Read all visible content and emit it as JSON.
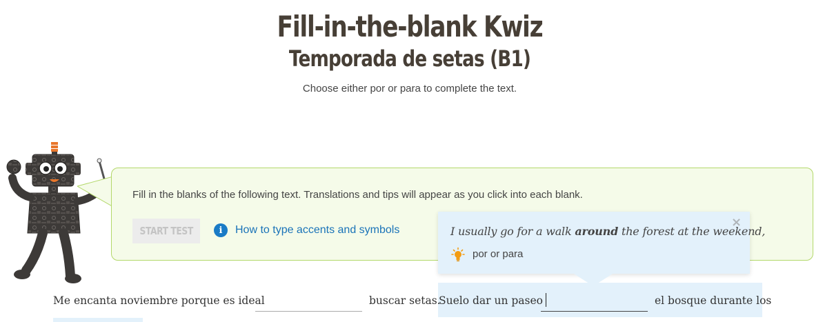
{
  "header": {
    "title": "Fill-in-the-blank Kwiz",
    "subtitle": "Temporada de setas (B1)",
    "instructions": "Choose either por or para to complete the text."
  },
  "intro": {
    "text": "Fill in the blanks of the following text. Translations and tips will appear as you click into each blank.",
    "start_button": "START TEST",
    "accents_link": "How to type accents and symbols"
  },
  "tooltip": {
    "translation_before": "I usually go for a walk ",
    "translation_bold": "around",
    "translation_after": " the forest at the weekend,",
    "hint": "por or para",
    "close_icon": "close-icon"
  },
  "exercise": {
    "segment_1": "Me encanta noviembre porque es ideal",
    "blank_1_value": "",
    "segment_2": "buscar setas.",
    "segment_3": "Suelo dar un paseo",
    "blank_2_value": "",
    "segment_4": "el bosque durante los"
  },
  "colors": {
    "title": "#473f36",
    "bubble_bg": "#f5fbe9",
    "bubble_border": "#b3d86a",
    "link": "#1a73b8",
    "tooltip_bg": "#e3f1fb",
    "bulb": "#f39c12"
  }
}
